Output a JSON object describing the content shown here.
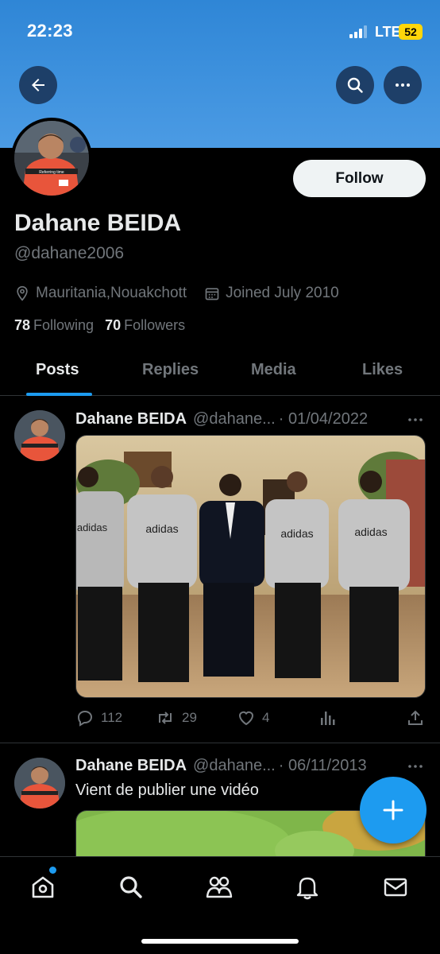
{
  "status_bar": {
    "time": "22:23",
    "network": "LTE",
    "battery": "52"
  },
  "header": {
    "back_icon": "arrow-left-icon",
    "search_icon": "search-icon",
    "more_icon": "more-horizontal-icon"
  },
  "profile": {
    "name": "Dahane BEIDA",
    "handle": "@dahane2006",
    "location": "Mauritania,Nouakchott",
    "joined": "Joined July 2010",
    "following_count": "78",
    "following_label": "Following",
    "followers_count": "70",
    "followers_label": "Followers",
    "follow_label": "Follow",
    "avatar_caption": "Referring time"
  },
  "tabs": [
    {
      "label": "Posts",
      "active": true
    },
    {
      "label": "Replies",
      "active": false
    },
    {
      "label": "Media",
      "active": false
    },
    {
      "label": "Likes",
      "active": false
    }
  ],
  "posts": [
    {
      "name": "Dahane BEIDA",
      "handle": "@dahane...",
      "date": "· 01/04/2022",
      "image_text": "adidas",
      "replies": "112",
      "reposts": "29",
      "likes": "4"
    },
    {
      "name": "Dahane BEIDA",
      "handle": "@dahane...",
      "date": "· 06/11/2013",
      "text": "Vient de publier une vidéo"
    }
  ],
  "colors": {
    "accent": "#1d9bf0",
    "banner": "#3a8fdd",
    "background": "#000000",
    "muted_text": "#71767b"
  },
  "nav": {
    "items": [
      "home-icon",
      "search-icon",
      "communities-icon",
      "notifications-icon",
      "messages-icon"
    ]
  }
}
